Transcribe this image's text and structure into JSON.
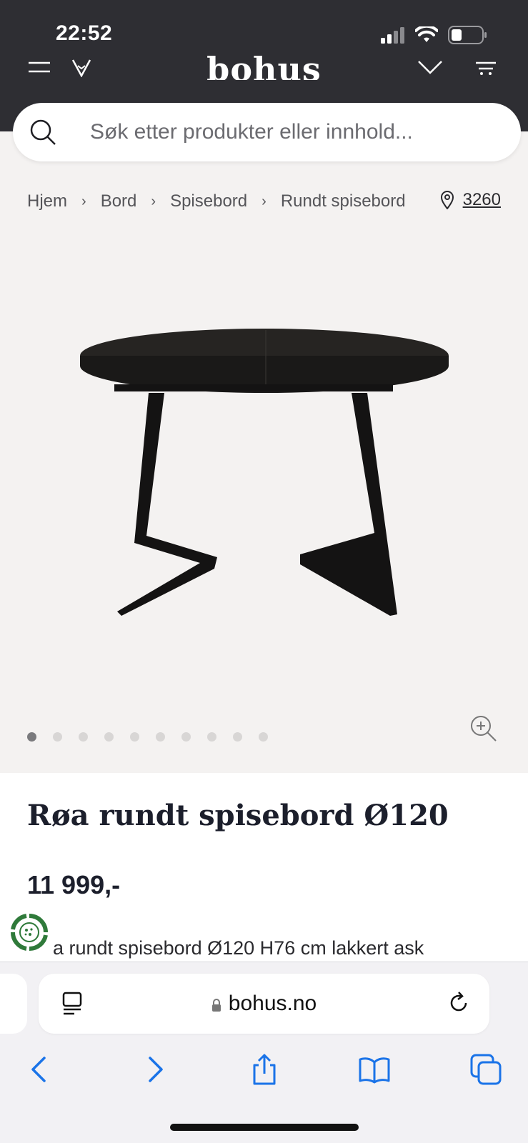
{
  "status_bar": {
    "time": "22:52"
  },
  "header": {
    "logo": "bohus"
  },
  "search": {
    "placeholder": "Søk etter produkter eller innhold..."
  },
  "breadcrumb": {
    "items": [
      "Hjem",
      "Bord",
      "Spisebord",
      "Rundt spisebord"
    ],
    "separator": "›"
  },
  "location": {
    "postcode": "3260"
  },
  "gallery": {
    "image_count": 10,
    "active_index": 0
  },
  "product": {
    "title": "Røa rundt spisebord Ø120",
    "price": "11 999,-",
    "description_partial": "a rundt spisebord Ø120 H76 cm lakkert ask"
  },
  "browser": {
    "url": "bohus.no"
  },
  "colors": {
    "header_bg": "#2e2e33",
    "page_bg": "#f4f2f1",
    "accent_blue": "#1a73e8",
    "title": "#1c1f2c"
  }
}
